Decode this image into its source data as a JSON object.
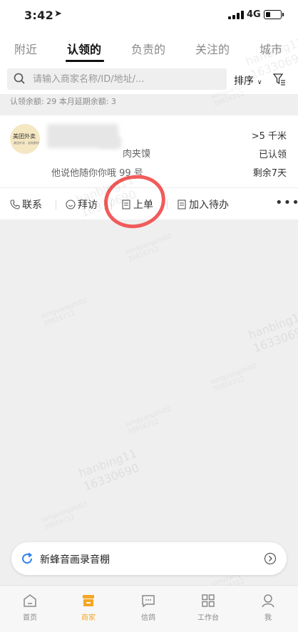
{
  "status_bar": {
    "time": "3:42",
    "network": "4G"
  },
  "tabs": [
    {
      "label": "附近",
      "active": false
    },
    {
      "label": "认领的",
      "active": true
    },
    {
      "label": "负责的",
      "active": false
    },
    {
      "label": "关注的",
      "active": false
    },
    {
      "label": "城市",
      "active": false
    }
  ],
  "search": {
    "placeholder": "请输入商家名称/ID/地址/...",
    "sort_label": "排序"
  },
  "summary": "认领余额: 29  本月延期余额: 3",
  "merchant": {
    "logo_text": "美团外卖",
    "logo_subtext": "美团外卖 · 送啥都快",
    "category_suffix": "肉夹馍",
    "description": "他说他随你你哦 99 号",
    "distance": ">5 千米",
    "status": "已认领",
    "days_left": "剩余7天",
    "actions": [
      "联系",
      "拜访",
      "上单",
      "加入待办"
    ],
    "more": "•••"
  },
  "recorder": {
    "label": "新蜂音画录音棚"
  },
  "bottom_nav": [
    {
      "label": "首页",
      "icon": "home-icon",
      "active": false
    },
    {
      "label": "商家",
      "icon": "store-icon",
      "active": true
    },
    {
      "label": "信鸽",
      "icon": "message-icon",
      "active": false
    },
    {
      "label": "工作台",
      "icon": "grid-icon",
      "active": false
    },
    {
      "label": "我",
      "icon": "person-icon",
      "active": false
    }
  ],
  "watermarks": {
    "name": "hanbing11",
    "id": "16330690",
    "small_name": "songyangzhi02",
    "small_id": "39816712"
  },
  "colors": {
    "accent": "#f5a623",
    "highlight": "#f15b5b",
    "recorder_icon": "#2f80ed"
  }
}
